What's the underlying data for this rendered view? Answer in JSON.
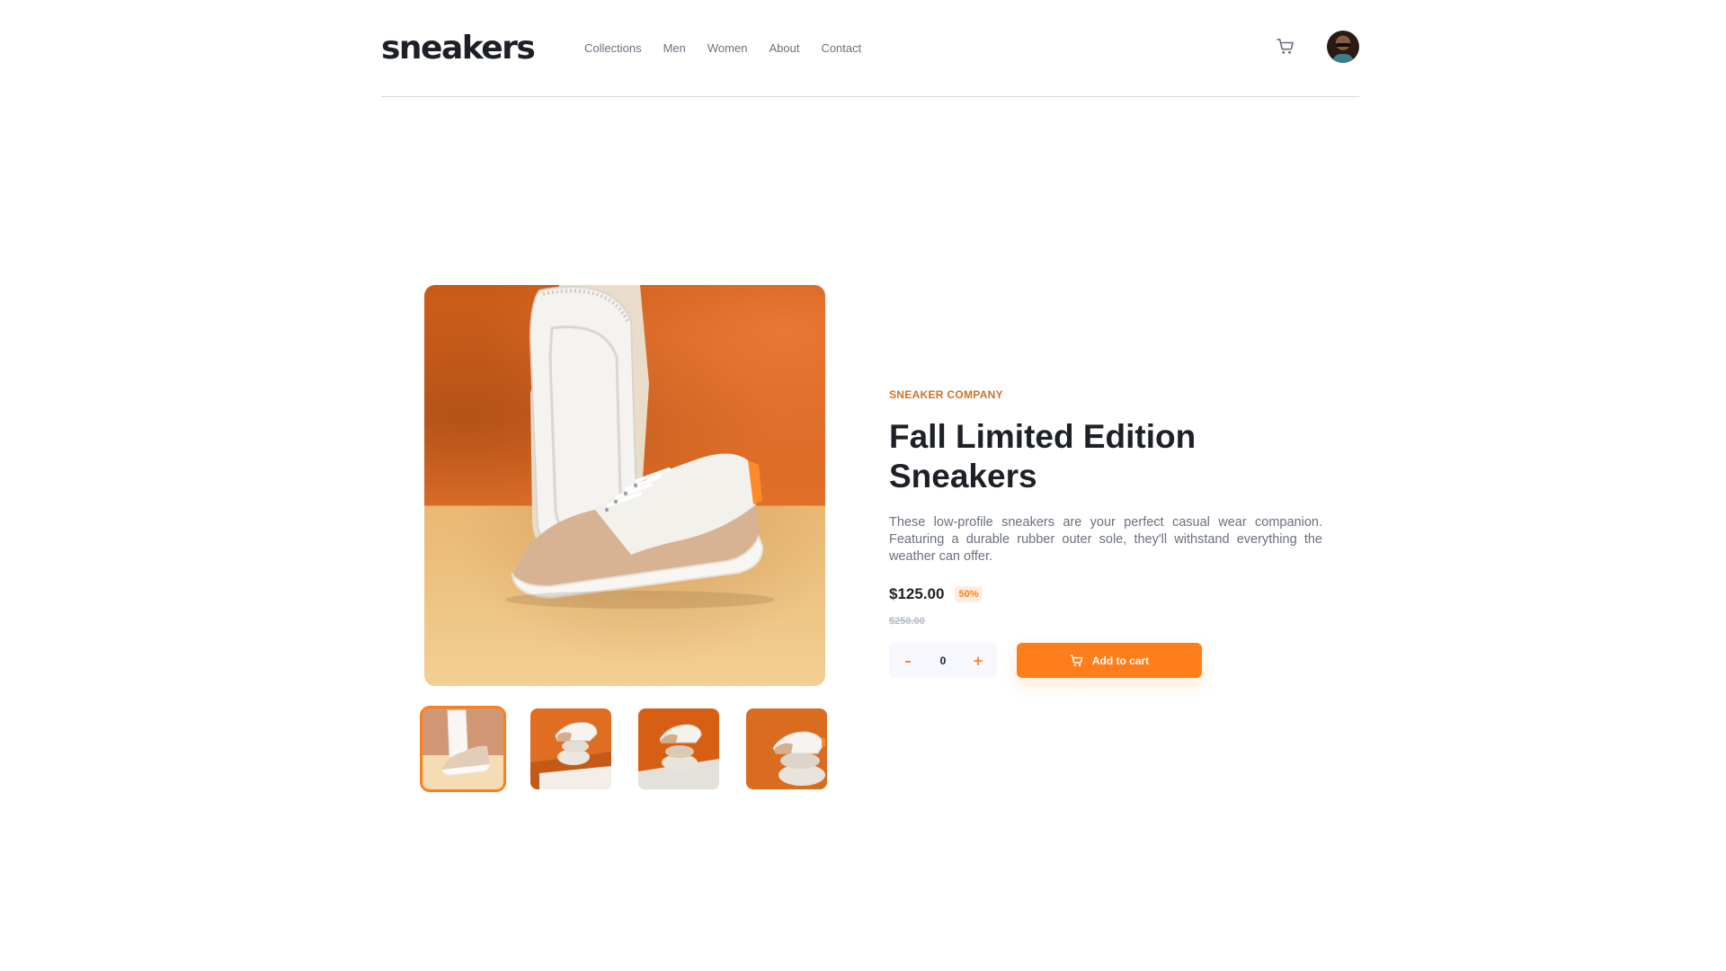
{
  "header": {
    "logo": "sneakers",
    "nav": [
      "Collections",
      "Men",
      "Women",
      "About",
      "Contact"
    ],
    "cart_icon": "cart-icon",
    "avatar_icon": "user-avatar"
  },
  "product": {
    "company": "SNEAKER COMPANY",
    "title": "Fall Limited Edition Sneakers",
    "description": "These low-profile sneakers are your perfect casual wear companion. Featuring a durable rubber outer sole, they'll withstand everything the weather can offer.",
    "price": "$125.00",
    "discount": "50%",
    "original_price": "$250.00"
  },
  "cart_controls": {
    "minus": "–",
    "quantity": "0",
    "plus": "+",
    "add_label": "Add to cart"
  },
  "gallery": {
    "thumbnail_count": 4,
    "active_thumbnail": 1
  },
  "colors": {
    "accent": "#ff7e1b",
    "accent_light": "#ffede0",
    "company_label": "#cf7128",
    "text_dark": "#1d2026",
    "text_gray": "#69707d",
    "text_light": "#b6bcc8"
  }
}
